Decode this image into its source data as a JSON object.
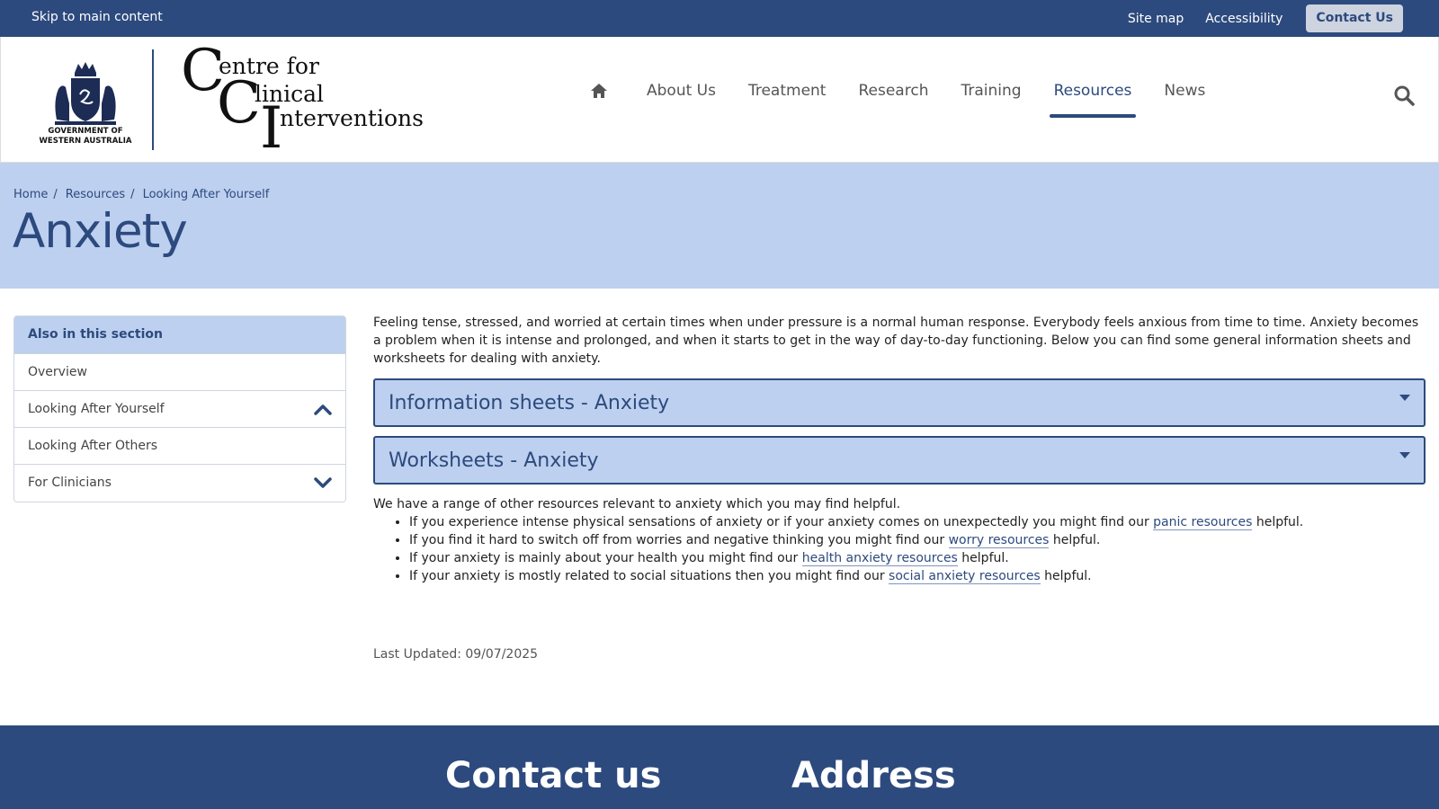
{
  "topbar": {
    "skip_link": "Skip to main content",
    "site_map": "Site map",
    "accessibility": "Accessibility",
    "contact_button": "Contact Us"
  },
  "header": {
    "gov_logo_text_line1": "GOVERNMENT OF",
    "gov_logo_text_line2": "WESTERN AUSTRALIA",
    "cci_logo": {
      "c1": "C",
      "c1_rest": "entre for",
      "c2": "C",
      "c2_rest": "linical",
      "i": "I",
      "i_rest": "nterventions"
    },
    "home_icon": "home-icon",
    "search_icon": "search-icon",
    "nav": [
      {
        "label": "About Us",
        "active": false
      },
      {
        "label": "Treatment",
        "active": false
      },
      {
        "label": "Research",
        "active": false
      },
      {
        "label": "Training",
        "active": false
      },
      {
        "label": "Resources",
        "active": true
      },
      {
        "label": "News",
        "active": false
      }
    ]
  },
  "banner": {
    "breadcrumb": [
      "Home",
      "Resources",
      "Looking After Yourself"
    ],
    "breadcrumb_separator": "/",
    "title": "Anxiety"
  },
  "sidebar": {
    "heading": "Also in this section",
    "items": [
      {
        "label": "Overview",
        "toggle": null
      },
      {
        "label": "Looking After Yourself",
        "toggle": "chevron-up-icon"
      },
      {
        "label": "Looking After Others",
        "toggle": null
      },
      {
        "label": "For Clinicians",
        "toggle": "chevron-down-icon"
      }
    ]
  },
  "main": {
    "intro": "Feeling tense, stressed, and worried at certain times when under pressure is a normal human response. Everybody feels anxious from time to time. Anxiety becomes a problem when it is intense and prolonged, and when it starts to get in the way of day-to-day functioning. Below you can find some general information sheets and worksheets for dealing with anxiety.",
    "accordions": [
      {
        "title": "Information sheets - Anxiety"
      },
      {
        "title": "Worksheets - Anxiety"
      }
    ],
    "resources_lead": "We have a range of other resources relevant to anxiety which you may find helpful.",
    "resources": [
      {
        "before": "If you experience intense physical sensations of anxiety or if your anxiety comes on unexpectedly you might find our ",
        "link": "panic resources",
        "after": " helpful."
      },
      {
        "before": "If you find it hard to switch off from worries and negative thinking you might find our ",
        "link": "worry resources",
        "after": " helpful."
      },
      {
        "before": "If your anxiety is mainly about your health you might find our ",
        "link": "health anxiety resources",
        "after": " helpful."
      },
      {
        "before": "If your anxiety is mostly related to social situations then you might find our ",
        "link": "social anxiety resources",
        "after": " helpful."
      }
    ],
    "last_updated": "Last Updated: 09/07/2025"
  },
  "footer": {
    "contact_title": "Contact us",
    "address_title": "Address"
  },
  "colors": {
    "primary": "#2d4a7e",
    "banner_bg": "#bdd0ef"
  }
}
